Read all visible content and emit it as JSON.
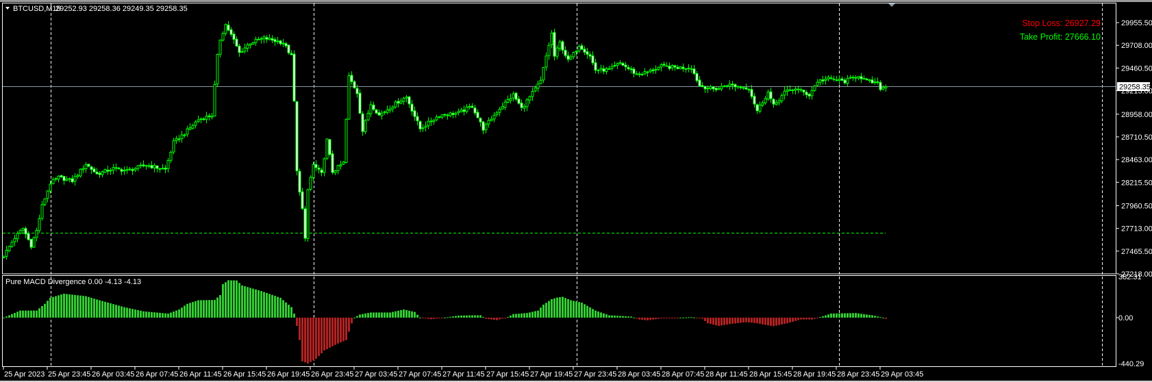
{
  "header": {
    "menu_icon": "triangle-down-icon",
    "symbol": "BTCUSD,M15",
    "ohlc": "29252.93 29258.36 29249.35 29258.35"
  },
  "annotations": {
    "stop_loss": "Stop Loss: 26927.29",
    "take_profit": "Take Profit: 27666.10",
    "stop_loss_color": "#ff0000",
    "take_profit_color": "#00ff00"
  },
  "current_price": "29258.35",
  "indicator": {
    "label": "Pure MACD Divergence 0.00 -4.13 -4.13",
    "axis_labels": [
      "382.31",
      "0.00",
      "-440.29"
    ]
  },
  "colors": {
    "candle": "#00ff00",
    "hist_pos": "#32cd32",
    "hist_neg": "#b22222",
    "grid": "#ffffff",
    "price_line": "#8c9aa6"
  },
  "chart_data": [
    {
      "type": "candlestick",
      "title": "BTCUSD,M15",
      "ylim": [
        27218.0,
        29955.5
      ],
      "price_axis_labels": [
        "29955.50",
        "29708.00",
        "29460.50",
        "29213.00",
        "28958.00",
        "28710.50",
        "28463.00",
        "28215.50",
        "27960.50",
        "27713.00",
        "27465.50",
        "27218.00"
      ],
      "time_axis_labels": [
        "25 Apr 2023",
        "25 Apr 23:45",
        "26 Apr 03:45",
        "26 Apr 07:45",
        "26 Apr 11:45",
        "26 Apr 15:45",
        "26 Apr 19:45",
        "26 Apr 23:45",
        "27 Apr 03:45",
        "27 Apr 07:45",
        "27 Apr 11:45",
        "27 Apr 15:45",
        "27 Apr 19:45",
        "27 Apr 23:45",
        "28 Apr 03:45",
        "28 Apr 07:45",
        "28 Apr 11:45",
        "28 Apr 15:45",
        "28 Apr 19:45",
        "28 Apr 23:45",
        "29 Apr 03:45"
      ],
      "bars_per_time_label": 16,
      "bar_count": 323,
      "close_path_bar_price": [
        [
          0,
          27416
        ],
        [
          4,
          27613
        ],
        [
          7,
          27712
        ],
        [
          10,
          27527
        ],
        [
          12,
          27687
        ],
        [
          14,
          27959
        ],
        [
          17,
          28206
        ],
        [
          20,
          28268
        ],
        [
          25,
          28231
        ],
        [
          30,
          28416
        ],
        [
          34,
          28305
        ],
        [
          40,
          28366
        ],
        [
          45,
          28342
        ],
        [
          52,
          28404
        ],
        [
          59,
          28354
        ],
        [
          62,
          28650
        ],
        [
          66,
          28749
        ],
        [
          71,
          28898
        ],
        [
          76,
          28947
        ],
        [
          78,
          29589
        ],
        [
          79,
          29774
        ],
        [
          81,
          29935
        ],
        [
          84,
          29762
        ],
        [
          86,
          29626
        ],
        [
          90,
          29737
        ],
        [
          95,
          29787
        ],
        [
          102,
          29737
        ],
        [
          105,
          29589
        ],
        [
          106,
          29095
        ],
        [
          107,
          28330
        ],
        [
          109,
          27922
        ],
        [
          110,
          27588
        ],
        [
          111,
          28132
        ],
        [
          113,
          28404
        ],
        [
          116,
          28305
        ],
        [
          118,
          28675
        ],
        [
          120,
          28330
        ],
        [
          124,
          28428
        ],
        [
          126,
          29367
        ],
        [
          129,
          29194
        ],
        [
          131,
          28774
        ],
        [
          134,
          29070
        ],
        [
          137,
          28947
        ],
        [
          144,
          29095
        ],
        [
          147,
          29145
        ],
        [
          152,
          28799
        ],
        [
          159,
          28947
        ],
        [
          166,
          28972
        ],
        [
          171,
          29046
        ],
        [
          175,
          28799
        ],
        [
          181,
          29021
        ],
        [
          186,
          29169
        ],
        [
          189,
          29021
        ],
        [
          192,
          29145
        ],
        [
          196,
          29318
        ],
        [
          198,
          29589
        ],
        [
          200,
          29836
        ],
        [
          201,
          29589
        ],
        [
          203,
          29737
        ],
        [
          206,
          29540
        ],
        [
          208,
          29614
        ],
        [
          210,
          29713
        ],
        [
          214,
          29589
        ],
        [
          216,
          29441
        ],
        [
          221,
          29441
        ],
        [
          225,
          29515
        ],
        [
          231,
          29392
        ],
        [
          235,
          29416
        ],
        [
          240,
          29478
        ],
        [
          246,
          29466
        ],
        [
          251,
          29466
        ],
        [
          254,
          29268
        ],
        [
          259,
          29231
        ],
        [
          261,
          29240
        ],
        [
          264,
          29281
        ],
        [
          269,
          29255
        ],
        [
          272,
          29240
        ],
        [
          275,
          28996
        ],
        [
          279,
          29196
        ],
        [
          281,
          29048
        ],
        [
          285,
          29196
        ],
        [
          289,
          29240
        ],
        [
          294,
          29166
        ],
        [
          297,
          29315
        ],
        [
          301,
          29345
        ],
        [
          307,
          29315
        ],
        [
          312,
          29381
        ],
        [
          315,
          29315
        ],
        [
          319,
          29293
        ],
        [
          320,
          29240
        ],
        [
          322,
          29258.35
        ]
      ],
      "horizontal_lines": {
        "current_price": 29258.35,
        "take_profit": 27666.1
      }
    },
    {
      "type": "bar",
      "title": "Pure MACD Divergence",
      "ylim": [
        -440.29,
        382.31
      ],
      "histogram_path_bar_value": [
        [
          0,
          0
        ],
        [
          4,
          44
        ],
        [
          6,
          66
        ],
        [
          12,
          66
        ],
        [
          15,
          129
        ],
        [
          17,
          185
        ],
        [
          22,
          223
        ],
        [
          30,
          200
        ],
        [
          35,
          162
        ],
        [
          44,
          98
        ],
        [
          51,
          59
        ],
        [
          60,
          38
        ],
        [
          64,
          76
        ],
        [
          67,
          129
        ],
        [
          71,
          162
        ],
        [
          77,
          165
        ],
        [
          79,
          210
        ],
        [
          80,
          312
        ],
        [
          82,
          348
        ],
        [
          85,
          346
        ],
        [
          87,
          300
        ],
        [
          94,
          248
        ],
        [
          101,
          185
        ],
        [
          105,
          98
        ],
        [
          106,
          38
        ],
        [
          107,
          -75
        ],
        [
          108,
          -203
        ],
        [
          109,
          -395
        ],
        [
          111,
          -415
        ],
        [
          114,
          -373
        ],
        [
          117,
          -298
        ],
        [
          122,
          -234
        ],
        [
          125,
          -203
        ],
        [
          127,
          -51
        ],
        [
          128,
          0
        ],
        [
          130,
          29
        ],
        [
          134,
          48
        ],
        [
          141,
          48
        ],
        [
          146,
          76
        ],
        [
          150,
          53
        ],
        [
          152,
          0
        ],
        [
          156,
          -14
        ],
        [
          161,
          0
        ],
        [
          166,
          19
        ],
        [
          171,
          22
        ],
        [
          174,
          22
        ],
        [
          176,
          -10
        ],
        [
          180,
          -22
        ],
        [
          184,
          6
        ],
        [
          186,
          33
        ],
        [
          191,
          43
        ],
        [
          195,
          66
        ],
        [
          197,
          121
        ],
        [
          200,
          172
        ],
        [
          202,
          187
        ],
        [
          204,
          194
        ],
        [
          207,
          162
        ],
        [
          211,
          140
        ],
        [
          216,
          66
        ],
        [
          221,
          22
        ],
        [
          229,
          10
        ],
        [
          232,
          -17
        ],
        [
          235,
          -24
        ],
        [
          241,
          -3
        ],
        [
          247,
          0
        ],
        [
          251,
          5
        ],
        [
          255,
          -10
        ],
        [
          257,
          -51
        ],
        [
          261,
          -75
        ],
        [
          265,
          -58
        ],
        [
          271,
          -41
        ],
        [
          275,
          -51
        ],
        [
          279,
          -70
        ],
        [
          281,
          -77
        ],
        [
          286,
          -51
        ],
        [
          291,
          -16
        ],
        [
          295,
          -16
        ],
        [
          299,
          13
        ],
        [
          302,
          38
        ],
        [
          311,
          43
        ],
        [
          317,
          22
        ],
        [
          321,
          0
        ],
        [
          322,
          -10
        ]
      ]
    }
  ]
}
